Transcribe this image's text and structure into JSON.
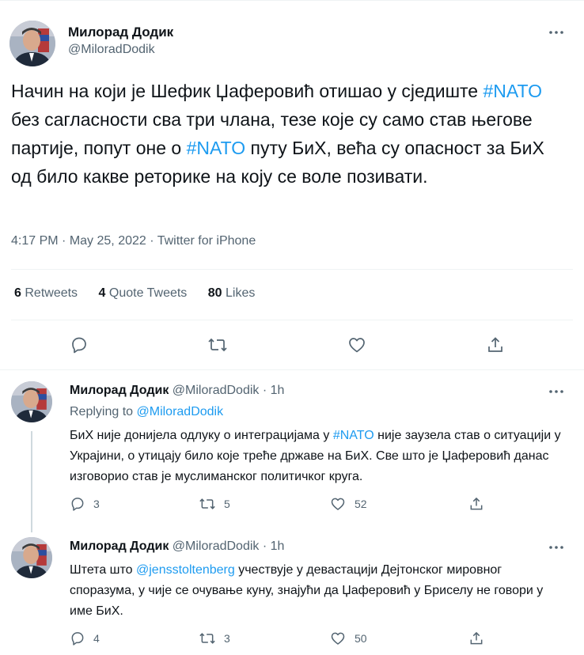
{
  "main_tweet": {
    "author_name": "Милорад Додик",
    "author_handle": "@MiloradDodik",
    "text_parts": [
      "Начин на који је Шефик Џаферовић отишао у сједиште ",
      "#NATO",
      " без сагласности сва три члана, тезе које су само став његове партије, попут оне о ",
      "#NATO",
      " путу БиХ, већа су опасност за БиХ од било какве реторике на коју се воле позивати."
    ],
    "time": "4:17 PM",
    "date": "May 25, 2022",
    "source": "Twitter for iPhone",
    "separator": "·",
    "stats": {
      "retweets_count": "6",
      "retweets_label": "Retweets",
      "quotes_count": "4",
      "quotes_label": "Quote Tweets",
      "likes_count": "80",
      "likes_label": "Likes"
    }
  },
  "replies": [
    {
      "author_name": "Милорад Додик",
      "author_handle": "@MiloradDodik",
      "time": "1h",
      "separator": "·",
      "replying_label": "Replying to",
      "replying_handle": "@MiloradDodik",
      "text_parts": [
        "БиХ није донијела одлуку о интеграцијама у ",
        "#NATO",
        " није заузела став о ситуацији у Украјини, о утицају било које треће државе на БиХ. Све што је Џаферовић данас изговорио став је муслиманског политичког круга."
      ],
      "reply_count": "3",
      "retweet_count": "5",
      "like_count": "52"
    },
    {
      "author_name": "Милорад Додик",
      "author_handle": "@MiloradDodik",
      "time": "1h",
      "separator": "·",
      "text_parts": [
        "Штета што ",
        "@jensstoltenberg",
        " учествује у девастацији Дејтонског мировног споразума, у чије се очување куну, знајући да Џаферовић у Бриселу не говори у име БиХ."
      ],
      "reply_count": "4",
      "retweet_count": "3",
      "like_count": "50"
    }
  ],
  "icons": {
    "more": "more-horizontal-icon",
    "reply": "reply-bubble-icon",
    "retweet": "retweet-icon",
    "like": "heart-icon",
    "share": "share-icon"
  },
  "colors": {
    "accent": "#1d9bf0",
    "text": "#0f1419",
    "muted": "#536471",
    "divider": "#eff3f4"
  }
}
